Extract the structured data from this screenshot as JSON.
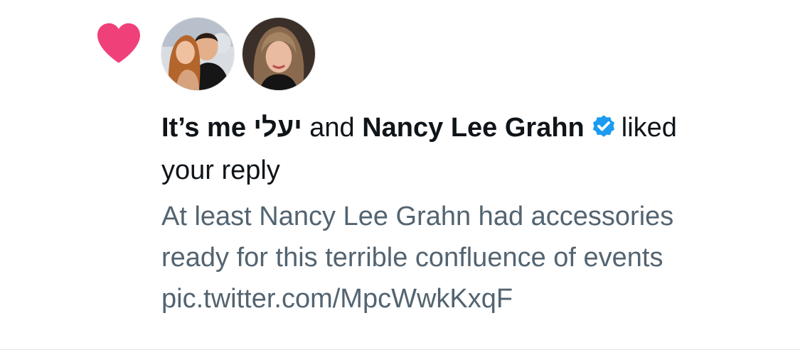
{
  "notification": {
    "type_icon": "heart-icon",
    "accent_color": "#f91880",
    "avatars": [
      {
        "name": "avatar-couple",
        "alt_icon": "avatar-photo"
      },
      {
        "name": "avatar-nancy",
        "alt_icon": "avatar-photo"
      }
    ],
    "user1_name": "It’s me יעלי",
    "connector": "and",
    "user2_name": "Nancy Lee Grahn",
    "verified_badge": "verified-badge-icon",
    "verified_color": "#1d9bf0",
    "action_part1": "liked",
    "action_part2": "your reply",
    "tweet_lines": [
      "At least Nancy Lee Grahn had accessories",
      "ready for this terrible confluence of events",
      "pic.twitter.com/MpcWwkKxqF"
    ]
  }
}
